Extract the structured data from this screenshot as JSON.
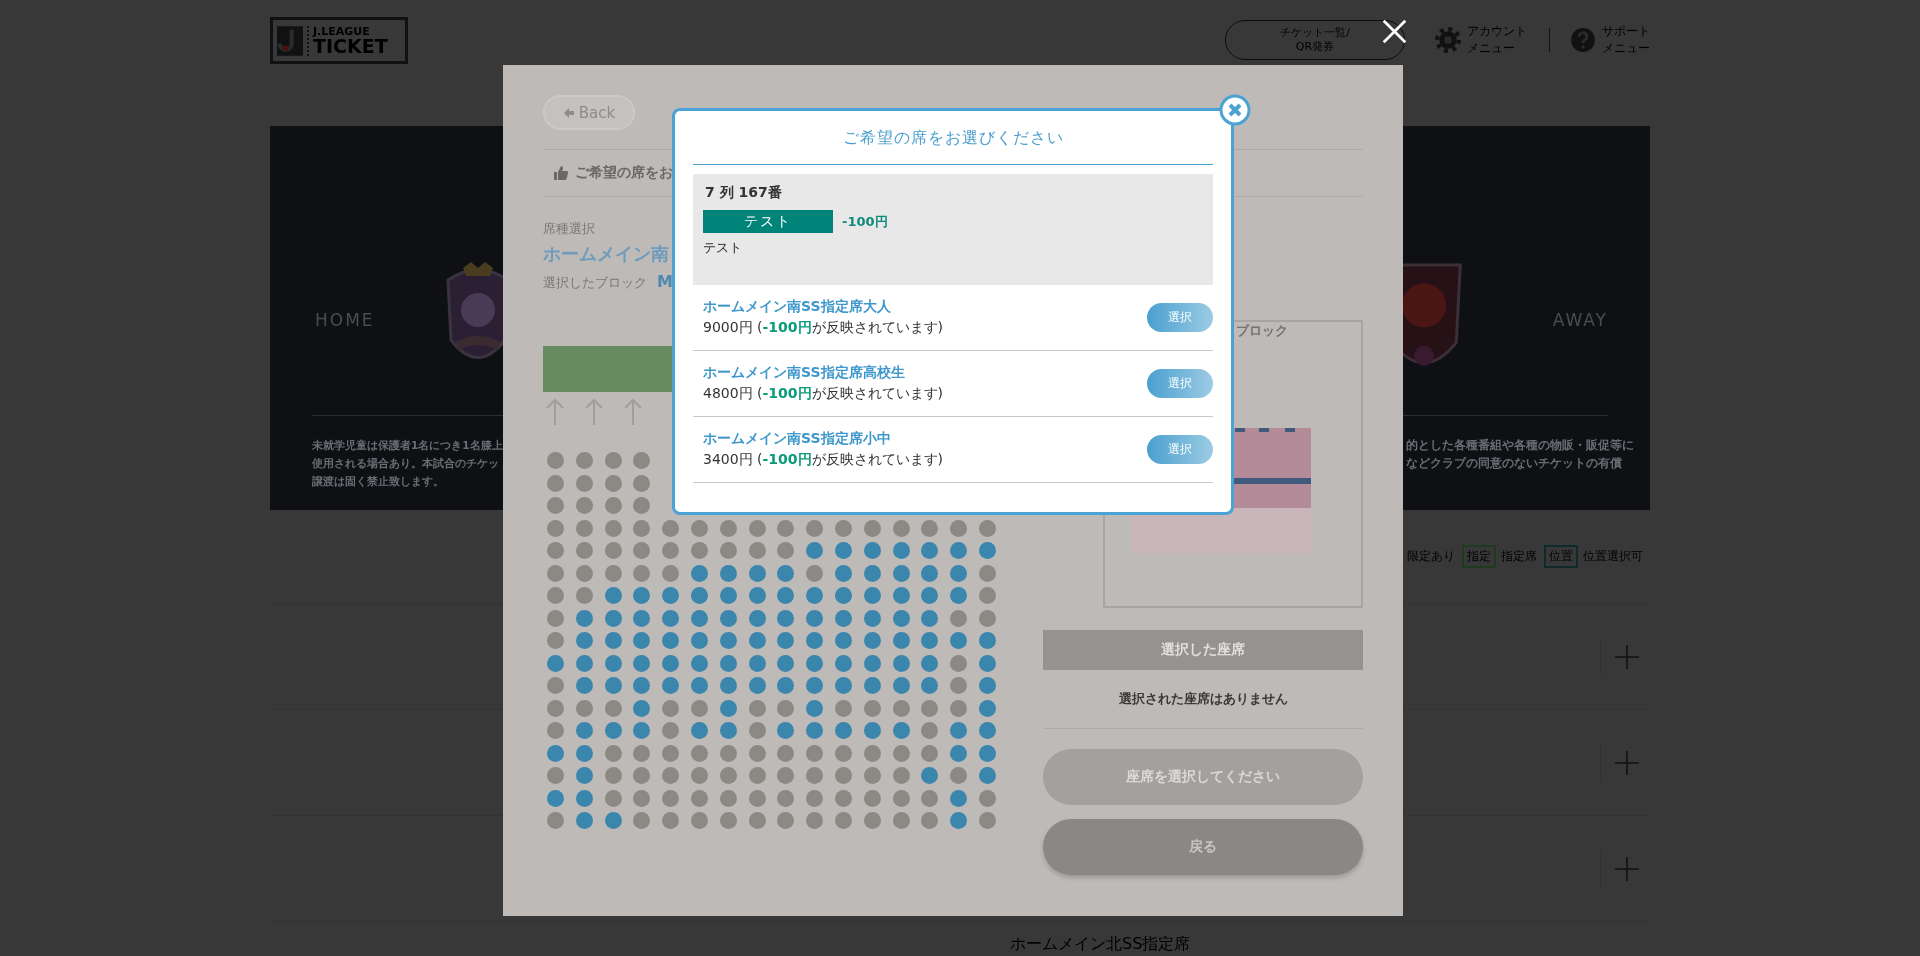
{
  "header": {
    "logo": {
      "line1": "J.LEAGUE",
      "line2": "TICKET"
    },
    "ticket_button": [
      "チケット一覧/",
      "QR発券"
    ],
    "account_menu": [
      "アカウント",
      "メニュー"
    ],
    "support_menu": [
      "サポート",
      "メニュー"
    ]
  },
  "banner": {
    "home": "HOME",
    "away": "AWAY",
    "notice_left": [
      "未就学児童は保護者1名につき1名膝上",
      "使用される場合あり。本試合のチケッ",
      "譲渡は固く禁止致します。"
    ],
    "notice_right": [
      "的とした各種番組や各種の物販・販促等に",
      "などクラブの同意のないチケットの有償"
    ]
  },
  "legend": [
    {
      "kind": "label",
      "text": "限定あり"
    },
    {
      "kind": "badge",
      "text": "指定",
      "color": "#1f3a1f"
    },
    {
      "kind": "label",
      "text": "指定席"
    },
    {
      "kind": "badge",
      "text": "位置",
      "color": "#10292b"
    },
    {
      "kind": "label",
      "text": "位置選択可"
    }
  ],
  "seat_type_rows": [
    {
      "expanded": false
    },
    {
      "expanded": false
    },
    {
      "expanded": false
    }
  ],
  "next_section": "ホームメイン北SS指定席",
  "sheet": {
    "back": "Back",
    "instruction": "ご希望の席をお",
    "seat_type_label": "席種選択",
    "seat_type": "ホームメイン南",
    "block_label": "選択したブロック",
    "block": "M",
    "seat_rows": [
      {
        "seats": [
          false,
          false,
          false,
          false
        ]
      },
      {
        "seats": [
          false,
          false,
          false,
          false
        ]
      },
      {
        "seats": [
          false,
          false,
          false,
          false
        ]
      },
      {
        "seats": [
          false,
          false,
          false,
          false,
          false,
          false,
          false,
          false,
          false,
          false,
          false,
          false,
          false,
          false,
          false,
          false
        ]
      },
      {
        "seats": [
          false,
          false,
          false,
          false,
          false,
          false,
          false,
          false,
          false,
          true,
          true,
          true,
          true,
          true,
          true,
          true
        ]
      },
      {
        "seats": [
          false,
          false,
          false,
          false,
          false,
          true,
          true,
          true,
          true,
          false,
          true,
          true,
          true,
          true,
          true,
          false
        ]
      },
      {
        "seats": [
          false,
          false,
          true,
          true,
          true,
          true,
          true,
          true,
          true,
          true,
          true,
          true,
          true,
          true,
          true,
          false
        ]
      },
      {
        "seats": [
          false,
          true,
          true,
          true,
          true,
          true,
          true,
          true,
          true,
          true,
          true,
          true,
          true,
          true,
          false,
          false
        ]
      },
      {
        "seats": [
          false,
          true,
          true,
          true,
          true,
          true,
          true,
          true,
          true,
          true,
          true,
          true,
          true,
          true,
          true,
          true
        ]
      },
      {
        "seats": [
          true,
          true,
          true,
          true,
          true,
          true,
          true,
          true,
          true,
          true,
          true,
          true,
          true,
          true,
          false,
          true
        ]
      },
      {
        "seats": [
          false,
          true,
          true,
          true,
          true,
          true,
          true,
          true,
          true,
          true,
          true,
          true,
          true,
          true,
          false,
          true
        ]
      },
      {
        "seats": [
          false,
          false,
          false,
          true,
          false,
          false,
          true,
          false,
          false,
          true,
          false,
          false,
          false,
          false,
          false,
          true
        ]
      },
      {
        "seats": [
          false,
          true,
          true,
          true,
          false,
          true,
          true,
          false,
          true,
          true,
          true,
          true,
          true,
          false,
          true,
          true
        ]
      },
      {
        "seats": [
          true,
          true,
          false,
          false,
          false,
          false,
          false,
          false,
          false,
          false,
          false,
          false,
          false,
          false,
          true,
          true
        ]
      },
      {
        "seats": [
          false,
          true,
          false,
          false,
          false,
          false,
          false,
          false,
          false,
          false,
          false,
          false,
          false,
          true,
          false,
          true
        ]
      },
      {
        "seats": [
          true,
          true,
          false,
          false,
          false,
          false,
          false,
          false,
          false,
          false,
          false,
          false,
          false,
          false,
          true,
          false
        ]
      },
      {
        "seats": [
          false,
          true,
          true,
          false,
          false,
          false,
          false,
          false,
          false,
          false,
          false,
          false,
          false,
          false,
          true,
          false
        ]
      }
    ],
    "block_map_title": "ブロック",
    "selected_header": "選択した座席",
    "no_selection": "選択された座席はありません",
    "confirm_button": {
      "label": "座席を選択してください",
      "disabled": true
    },
    "return_button": "戻る"
  },
  "modal": {
    "title": "ご希望の席をお選びください",
    "seat": "7 列 167番",
    "discount": {
      "tag": "テスト",
      "amount": "-100円",
      "note": "テスト"
    },
    "ticket_types": [
      {
        "name": "ホームメイン南SS指定席大人",
        "price": "9000円 (**-100円**が反映されています)",
        "button": "選択"
      },
      {
        "name": "ホームメイン南SS指定席高校生",
        "price": "4800円 (**-100円**が反映されています)",
        "button": "選択"
      },
      {
        "name": "ホームメイン南SS指定席小中",
        "price": "3400円 (**-100円**が反映されています)",
        "button": "選択"
      }
    ]
  }
}
